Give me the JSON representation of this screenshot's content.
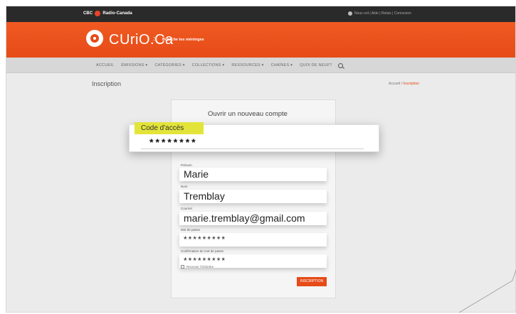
{
  "topbar": {
    "brand": "CBC",
    "brand2": "Radio-Canada",
    "links": "Nous ont  |  Aide  |  Relais  |  Connexion"
  },
  "header": {
    "logo_text": "CUriO.Ca",
    "separator": ">",
    "tagline": "Branche tes méninges"
  },
  "nav": {
    "items": [
      "Accueil",
      "Émissions ▾",
      "Catégories ▾",
      "Collections ▾",
      "Ressources ▾",
      "Chaînes ▾",
      "Quoi de neuf?"
    ]
  },
  "page": {
    "title": "Inscription",
    "breadcrumb": {
      "home": "Accueil",
      "separator": "/",
      "current": "Inscription"
    }
  },
  "form": {
    "heading": "Ouvrir un nouveau compte",
    "access_code": {
      "label": "Code d'accès",
      "value": "********"
    },
    "fields": [
      {
        "label": "Prénom",
        "value": "Marie"
      },
      {
        "label": "Nom",
        "value": "Tremblay"
      },
      {
        "label": "Courriel",
        "value": "marie.tremblay@gmail.com"
      },
      {
        "label": "Mot de passe",
        "value": "*********"
      },
      {
        "label": "Confirmation du mot de passe",
        "value": "*********"
      }
    ],
    "newsletter_label": "Recevoir l'infolettre",
    "submit_label": "Inscription"
  },
  "colors": {
    "brand_orange": "#e64b18",
    "highlight_yellow": "#e3e43a",
    "topbar": "#2a2a2a"
  }
}
